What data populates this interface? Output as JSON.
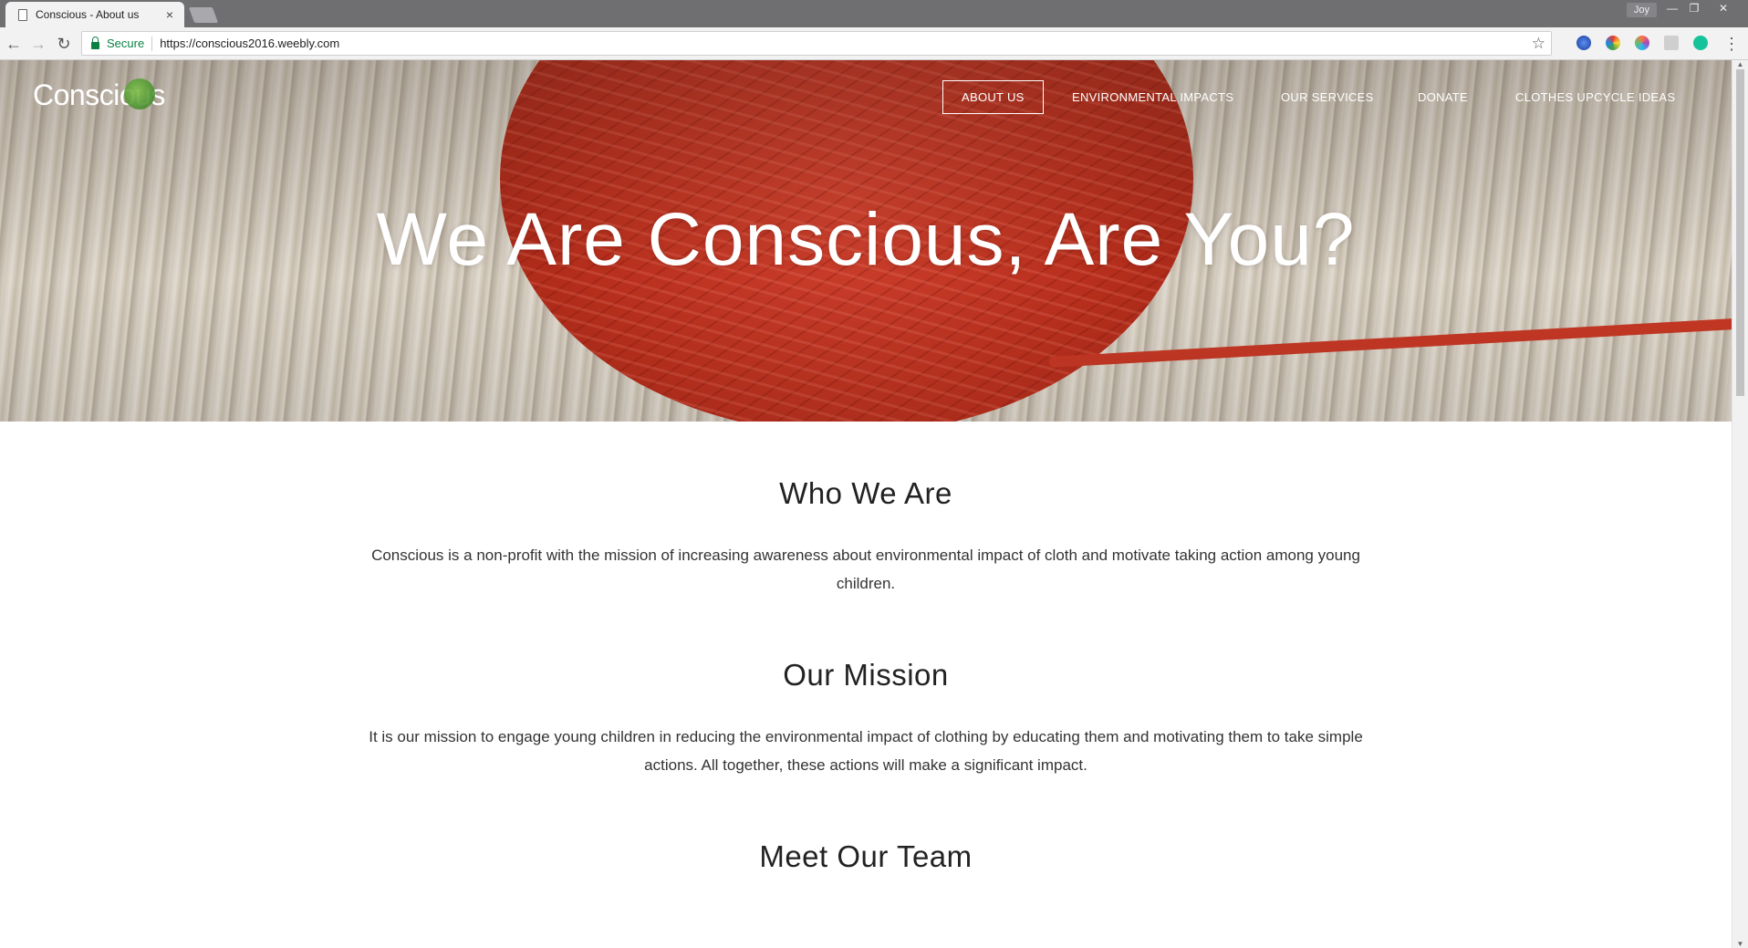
{
  "browser": {
    "tab_title": "Conscious - About us",
    "tab_close": "×",
    "user_name": "Joy",
    "secure_label": "Secure",
    "url": "https://conscious2016.weebly.com",
    "back_glyph": "←",
    "forward_glyph": "→",
    "reload_glyph": "↻",
    "star_glyph": "☆",
    "menu_glyph": "⋮",
    "minimize_glyph": "—",
    "restore_glyph": "❐",
    "close_glyph": "✕"
  },
  "site": {
    "logo_text": "Conscious",
    "nav": [
      {
        "label": "ABOUT US",
        "active": true
      },
      {
        "label": "ENVIRONMENTAL IMPACTS",
        "active": false
      },
      {
        "label": "OUR SERVICES",
        "active": false
      },
      {
        "label": "DONATE",
        "active": false
      },
      {
        "label": "CLOTHES UPCYCLE IDEAS",
        "active": false
      }
    ],
    "hero_title": "We Are Conscious, Are You?"
  },
  "content": {
    "who_title": "Who We Are",
    "who_text": "Conscious is a non-profit with the mission of increasing awareness about environmental impact of cloth and motivate taking action among young children.",
    "mission_title": "Our Mission",
    "mission_text": "It is our mission to engage young children in reducing the environmental impact of clothing by educating them and motivating them to take simple actions. All together, these actions will make a significant impact.",
    "team_title": "Meet Our Team"
  },
  "colors": {
    "secure_green": "#0b8043",
    "yarn_red": "#c3321f"
  }
}
